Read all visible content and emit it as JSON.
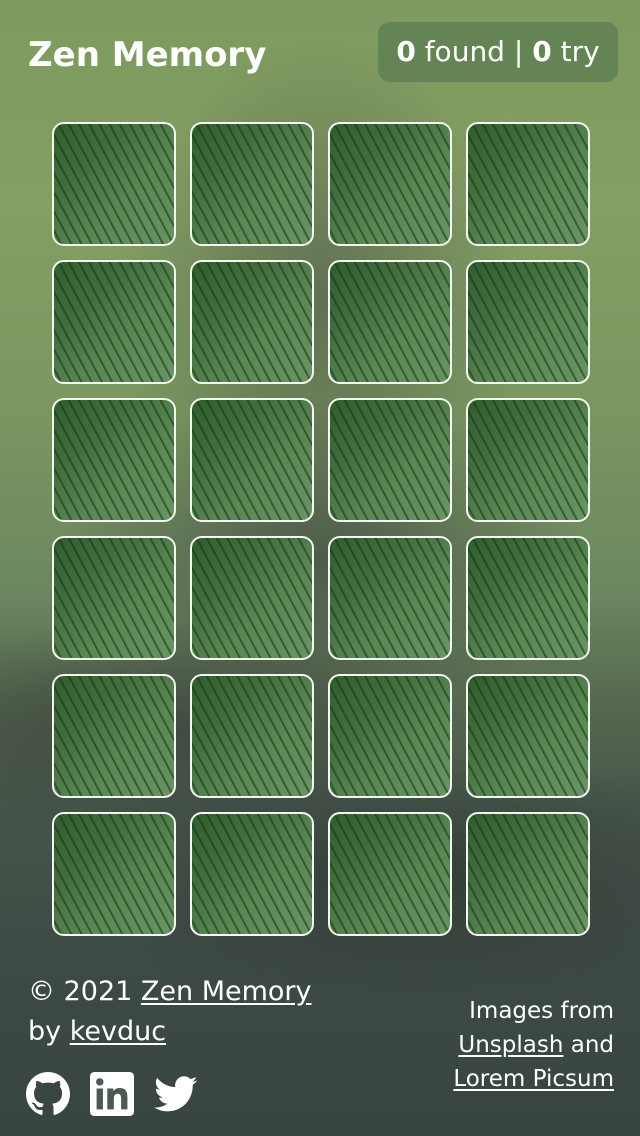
{
  "header": {
    "title": "Zen Memory",
    "score": {
      "found_count": "0",
      "found_label": "found",
      "separator": "|",
      "try_count": "0",
      "try_label": "try"
    }
  },
  "board": {
    "rows": 6,
    "columns": 4,
    "cards": [
      {
        "state": "face-down"
      },
      {
        "state": "face-down"
      },
      {
        "state": "face-down"
      },
      {
        "state": "face-down"
      },
      {
        "state": "face-down"
      },
      {
        "state": "face-down"
      },
      {
        "state": "face-down"
      },
      {
        "state": "face-down"
      },
      {
        "state": "face-down"
      },
      {
        "state": "face-down"
      },
      {
        "state": "face-down"
      },
      {
        "state": "face-down"
      },
      {
        "state": "face-down"
      },
      {
        "state": "face-down"
      },
      {
        "state": "face-down"
      },
      {
        "state": "face-down"
      },
      {
        "state": "face-down"
      },
      {
        "state": "face-down"
      },
      {
        "state": "face-down"
      },
      {
        "state": "face-down"
      },
      {
        "state": "face-down"
      },
      {
        "state": "face-down"
      },
      {
        "state": "face-down"
      },
      {
        "state": "face-down"
      }
    ]
  },
  "footer": {
    "copyright": "© 2021",
    "app_link": "Zen Memory",
    "by": "by",
    "author_link": "kevduc",
    "socials": [
      "github-icon",
      "linkedin-icon",
      "twitter-icon"
    ],
    "credits_prefix": "Images from",
    "unsplash_link": "Unsplash",
    "and": "and",
    "picsum_link": "Lorem Picsum"
  },
  "colors": {
    "card_back": "#4e7a48",
    "card_border": "#f4f6f2",
    "score_bg": "#60805a",
    "text": "#ffffff"
  }
}
